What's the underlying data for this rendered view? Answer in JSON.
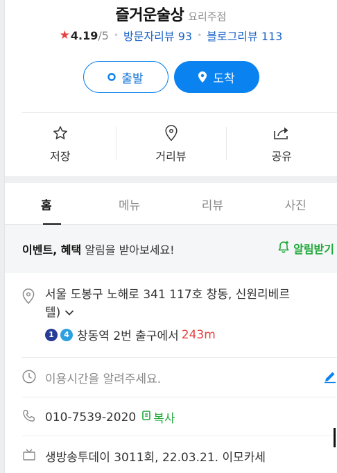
{
  "place": {
    "name": "즐거운술상",
    "category": "요리주점",
    "rating_value": "4.19",
    "rating_max": "/5",
    "visitor_reviews_label": "방문자리뷰 93",
    "blog_reviews_label": "블로그리뷰 113"
  },
  "route_buttons": {
    "depart": "출발",
    "arrive": "도착"
  },
  "actions": [
    {
      "label": "저장",
      "icon": "star-outline-icon"
    },
    {
      "label": "거리뷰",
      "icon": "location-pin-icon"
    },
    {
      "label": "공유",
      "icon": "share-icon"
    }
  ],
  "tabs": [
    {
      "label": "홈",
      "active": true
    },
    {
      "label": "메뉴",
      "active": false
    },
    {
      "label": "리뷰",
      "active": false
    },
    {
      "label": "사진",
      "active": false
    }
  ],
  "event": {
    "bold_text": "이벤트, 혜택",
    "text": " 알림을 받아보세요!",
    "notify_label": "알림받기"
  },
  "info": {
    "address_line1": "서울 도봉구 노해로 341 117호 창동, 신원리베르",
    "address_line2": "텔)",
    "subway_line_a": "1",
    "subway_line_b": "4",
    "subway_text": "창동역 2번 출구에서",
    "subway_distance": "243m",
    "hours_placeholder": "이용시간을 알려주세요.",
    "phone": "010-7539-2020",
    "copy_label": "복사",
    "tv": "생방송투데이 3011회, 22.03.21. 이모카세"
  },
  "colors": {
    "accent_blue": "#0a82f0",
    "link_blue": "#1b63c6",
    "star_red": "#e64040",
    "green": "#1fa839"
  }
}
